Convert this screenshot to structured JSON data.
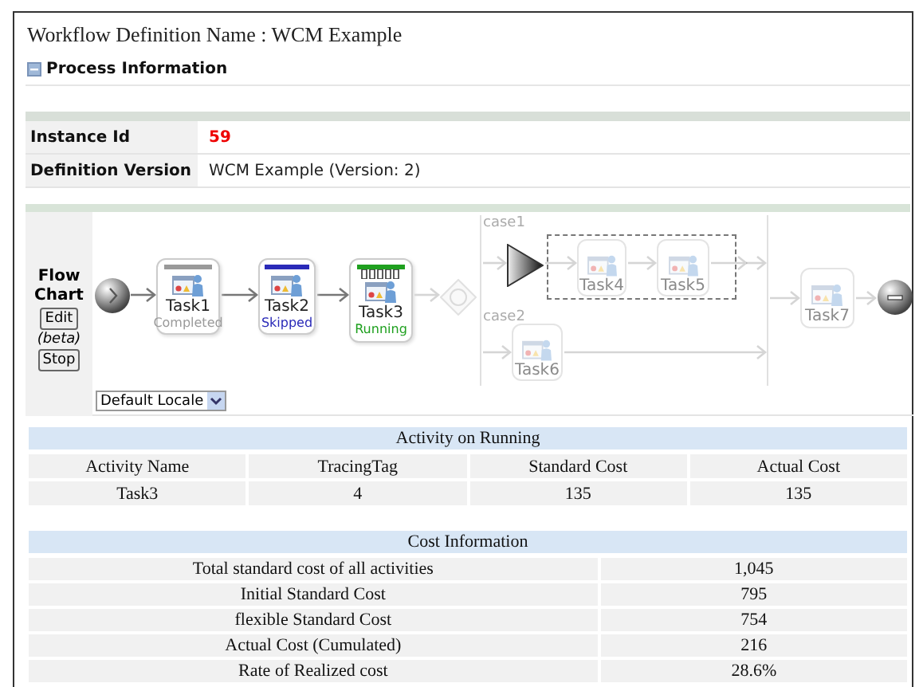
{
  "title_label": "Workflow Definition Name : WCM Example",
  "section": {
    "title": "Process Information",
    "expanded": true
  },
  "info_rows": [
    {
      "label": "Instance Id",
      "value": "59",
      "kind": "highlight"
    },
    {
      "label": "Definition Version",
      "value": "WCM Example (Version: 2)",
      "kind": "plain"
    }
  ],
  "flow_chart": {
    "label": "Flow Chart",
    "edit_button": "Edit",
    "beta_note": "(beta)",
    "stop_button": "Stop",
    "locale_select": "Default Locale",
    "branches": [
      {
        "label": "case1"
      },
      {
        "label": "case2"
      }
    ],
    "nodes": [
      {
        "kind": "start"
      },
      {
        "kind": "task",
        "name": "Task1",
        "status": "Completed",
        "color": "#9a9a9a",
        "disabled": false
      },
      {
        "kind": "task",
        "name": "Task2",
        "status": "Skipped",
        "color": "#2a2ab8",
        "disabled": false
      },
      {
        "kind": "task",
        "name": "Task3",
        "status": "Running",
        "color": "#1fa01f",
        "disabled": false
      },
      {
        "kind": "gateway"
      },
      {
        "kind": "split"
      },
      {
        "kind": "task",
        "name": "Task4",
        "disabled": true
      },
      {
        "kind": "task",
        "name": "Task5",
        "disabled": true
      },
      {
        "kind": "task",
        "name": "Task6",
        "disabled": true
      },
      {
        "kind": "task",
        "name": "Task7",
        "disabled": true
      },
      {
        "kind": "end"
      }
    ]
  },
  "activity_table": {
    "title": "Activity on Running",
    "columns": [
      "Activity Name",
      "TracingTag",
      "Standard Cost",
      "Actual Cost"
    ],
    "rows": [
      [
        "Task3",
        "4",
        "135",
        "135"
      ]
    ]
  },
  "cost_table": {
    "title": "Cost Information",
    "rows": [
      {
        "label": "Total standard cost of all activities",
        "value": "1,045"
      },
      {
        "label": "Initial Standard Cost",
        "value": "795"
      },
      {
        "label": "flexible Standard Cost",
        "value": "754"
      },
      {
        "label": "Actual Cost (Cumulated)",
        "value": "216"
      },
      {
        "label": "Rate of Realized cost",
        "value": "28.6%"
      }
    ]
  }
}
